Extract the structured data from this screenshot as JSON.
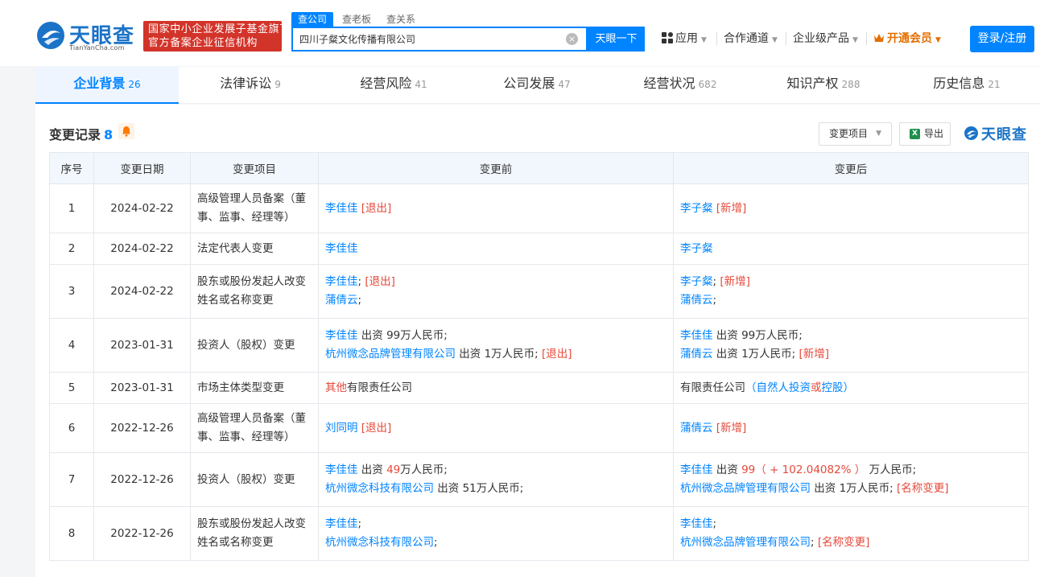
{
  "header": {
    "logo_text": "天眼查",
    "logo_sub": "TianYanCha.com",
    "banner_line1": "国家中小企业发展子基金旗下",
    "banner_line2": "官方备案企业征信机构",
    "search_tabs": [
      "查公司",
      "查老板",
      "查关系"
    ],
    "search_value": "四川子粲文化传播有限公司",
    "search_button": "天眼一下",
    "nav": [
      "应用",
      "合作通道",
      "企业级产品"
    ],
    "vip_label": "开通会员",
    "login_label": "登录/注册"
  },
  "tabs": [
    {
      "label": "企业背景",
      "count": "26"
    },
    {
      "label": "法律诉讼",
      "count": "9"
    },
    {
      "label": "经营风险",
      "count": "41"
    },
    {
      "label": "公司发展",
      "count": "47"
    },
    {
      "label": "经营状况",
      "count": "682"
    },
    {
      "label": "知识产权",
      "count": "288"
    },
    {
      "label": "历史信息",
      "count": "21"
    }
  ],
  "section": {
    "title": "变更记录",
    "count": "8",
    "filter_label": "变更项目",
    "export_label": "导出",
    "excel_glyph": "X",
    "brand": "天眼查"
  },
  "table": {
    "headers": [
      "序号",
      "变更日期",
      "变更项目",
      "变更前",
      "变更后"
    ],
    "rows": [
      {
        "no": "1",
        "date": "2024-02-22",
        "item": "高级管理人员备案（董事、监事、经理等）",
        "before": [
          [
            {
              "t": "李佳佳",
              "c": "lnk"
            },
            {
              "t": " [退出]",
              "c": "red"
            }
          ]
        ],
        "after": [
          [
            {
              "t": "李子粲",
              "c": "lnk"
            },
            {
              "t": " [新增]",
              "c": "red"
            }
          ]
        ]
      },
      {
        "no": "2",
        "date": "2024-02-22",
        "item": "法定代表人变更",
        "before": [
          [
            {
              "t": "李佳佳",
              "c": "lnk"
            }
          ]
        ],
        "after": [
          [
            {
              "t": "李子粲",
              "c": "lnk"
            }
          ]
        ]
      },
      {
        "no": "3",
        "date": "2024-02-22",
        "item": "股东或股份发起人改变姓名或名称变更",
        "before": [
          [
            {
              "t": "李佳佳",
              "c": "lnk"
            },
            {
              "t": "; ",
              "c": ""
            },
            {
              "t": "[退出]",
              "c": "red"
            }
          ],
          [
            {
              "t": "蒲倩云",
              "c": "lnk"
            },
            {
              "t": ";",
              "c": ""
            }
          ]
        ],
        "after": [
          [
            {
              "t": "李子粲",
              "c": "lnk"
            },
            {
              "t": "; ",
              "c": ""
            },
            {
              "t": "[新增]",
              "c": "red"
            }
          ],
          [
            {
              "t": "蒲倩云",
              "c": "lnk"
            },
            {
              "t": ";",
              "c": ""
            }
          ]
        ]
      },
      {
        "no": "4",
        "date": "2023-01-31",
        "item": "投资人（股权）变更",
        "before": [
          [
            {
              "t": "李佳佳",
              "c": "lnk"
            },
            {
              "t": " 出资 99万人民币;",
              "c": ""
            }
          ],
          [
            {
              "t": "杭州微念品牌管理有限公司",
              "c": "lnk"
            },
            {
              "t": " 出资 1万人民币; ",
              "c": ""
            },
            {
              "t": "[退出]",
              "c": "red"
            }
          ]
        ],
        "after": [
          [
            {
              "t": "李佳佳",
              "c": "lnk"
            },
            {
              "t": " 出资 99万人民币;",
              "c": ""
            }
          ],
          [
            {
              "t": "蒲倩云",
              "c": "lnk"
            },
            {
              "t": " 出资 1万人民币; ",
              "c": ""
            },
            {
              "t": "[新增]",
              "c": "red"
            }
          ]
        ]
      },
      {
        "no": "5",
        "date": "2023-01-31",
        "item": "市场主体类型变更",
        "before": [
          [
            {
              "t": "其他",
              "c": "red"
            },
            {
              "t": "有限责任公司",
              "c": ""
            }
          ]
        ],
        "after": [
          [
            {
              "t": "有限责任公司",
              "c": ""
            },
            {
              "t": "（自然人投资",
              "c": "lnk"
            },
            {
              "t": "或",
              "c": "red"
            },
            {
              "t": "控股）",
              "c": "lnk"
            }
          ]
        ]
      },
      {
        "no": "6",
        "date": "2022-12-26",
        "item": "高级管理人员备案（董事、监事、经理等）",
        "before": [
          [
            {
              "t": "刘同明",
              "c": "lnk"
            },
            {
              "t": " [退出]",
              "c": "red"
            }
          ]
        ],
        "after": [
          [
            {
              "t": "蒲倩云",
              "c": "lnk"
            },
            {
              "t": " [新增]",
              "c": "red"
            }
          ]
        ]
      },
      {
        "no": "7",
        "date": "2022-12-26",
        "item": "投资人（股权）变更",
        "before": [
          [
            {
              "t": "李佳佳",
              "c": "lnk"
            },
            {
              "t": " 出资 ",
              "c": ""
            },
            {
              "t": "49",
              "c": "red"
            },
            {
              "t": "万人民币;",
              "c": ""
            }
          ],
          [
            {
              "t": "杭州微念科技有限公司",
              "c": "lnk"
            },
            {
              "t": " 出资 51万人民币;",
              "c": ""
            }
          ]
        ],
        "after": [
          [
            {
              "t": "李佳佳",
              "c": "lnk"
            },
            {
              "t": " 出资 ",
              "c": ""
            },
            {
              "t": "99（ + 102.04082% ）",
              "c": "red"
            },
            {
              "t": " 万人民币;",
              "c": ""
            }
          ],
          [
            {
              "t": "杭州微念品牌管理有限公司",
              "c": "lnk"
            },
            {
              "t": " 出资 1万人民币; ",
              "c": ""
            },
            {
              "t": "[名称变更]",
              "c": "red"
            }
          ]
        ]
      },
      {
        "no": "8",
        "date": "2022-12-26",
        "item": "股东或股份发起人改变姓名或名称变更",
        "before": [
          [
            {
              "t": "李佳佳",
              "c": "lnk"
            },
            {
              "t": ";",
              "c": ""
            }
          ],
          [
            {
              "t": "杭州微念科技有限公司",
              "c": "lnk"
            },
            {
              "t": ";",
              "c": ""
            }
          ]
        ],
        "after": [
          [
            {
              "t": "李佳佳",
              "c": "lnk"
            },
            {
              "t": ";",
              "c": ""
            }
          ],
          [
            {
              "t": "杭州微念品牌管理有限公司",
              "c": "lnk"
            },
            {
              "t": "; ",
              "c": ""
            },
            {
              "t": "[名称变更]",
              "c": "red"
            }
          ]
        ]
      }
    ]
  },
  "colors": {
    "accent": "#0084ff",
    "brand_blue": "#1b73c8",
    "banner_red": "#d3342a",
    "highlight_red": "#e5493a",
    "vip_orange": "#e46f00"
  }
}
